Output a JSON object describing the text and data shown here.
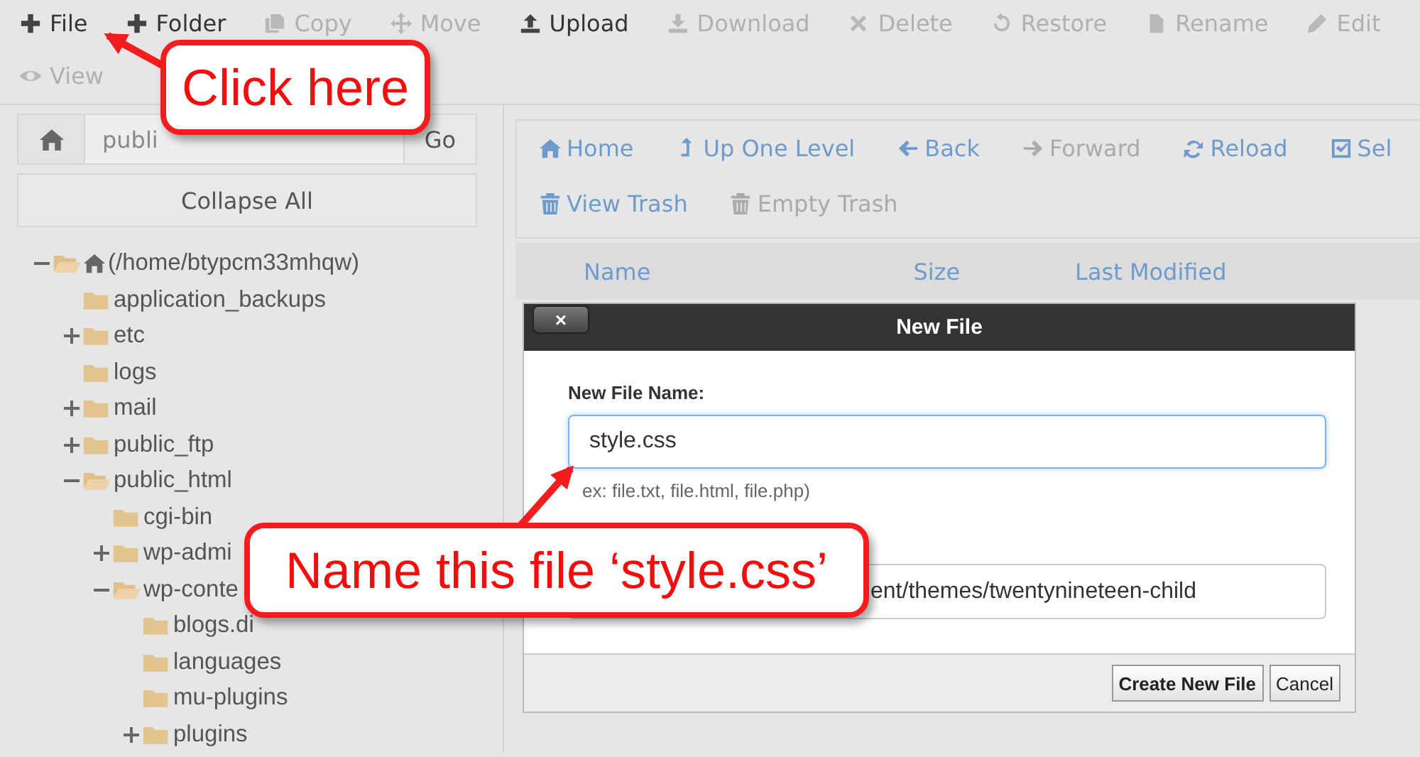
{
  "toolbar": {
    "rows": [
      [
        {
          "label": "File",
          "kind": "plus",
          "disabled": false
        },
        {
          "label": "Folder",
          "kind": "plus",
          "disabled": false
        },
        {
          "label": "Copy",
          "kind": "copy",
          "disabled": true
        },
        {
          "label": "Move",
          "kind": "move",
          "disabled": true
        },
        {
          "label": "Upload",
          "kind": "upload",
          "disabled": false
        },
        {
          "label": "Download",
          "kind": "download",
          "disabled": true
        },
        {
          "label": "Delete",
          "kind": "delete",
          "disabled": true
        },
        {
          "label": "Restore",
          "kind": "restore",
          "disabled": true
        },
        {
          "label": "Rename",
          "kind": "file",
          "disabled": true
        },
        {
          "label": "Edit",
          "kind": "pencil",
          "disabled": true
        }
      ],
      [
        {
          "label": "View",
          "kind": "eye",
          "disabled": true
        }
      ]
    ]
  },
  "path_bar": {
    "value": "publi",
    "go_label": "Go"
  },
  "collapse_label": "Collapse All",
  "tree": [
    {
      "label": "(/home/btypcm33mhqw)",
      "kind": "home",
      "expandable": true,
      "expanded": true,
      "children": [
        {
          "label": "application_backups",
          "kind": "folder",
          "expandable": false,
          "expanded": false
        },
        {
          "label": "etc",
          "kind": "folder",
          "expandable": true,
          "expanded": false
        },
        {
          "label": "logs",
          "kind": "folder",
          "expandable": false,
          "expanded": false
        },
        {
          "label": "mail",
          "kind": "folder",
          "expandable": true,
          "expanded": false
        },
        {
          "label": "public_ftp",
          "kind": "folder",
          "expandable": true,
          "expanded": false
        },
        {
          "label": "public_html",
          "kind": "folder",
          "expandable": true,
          "expanded": true,
          "children": [
            {
              "label": "cgi-bin",
              "kind": "folder",
              "expandable": false,
              "expanded": false
            },
            {
              "label": "wp-admi",
              "kind": "folder",
              "expandable": true,
              "expanded": false
            },
            {
              "label": "wp-conte",
              "kind": "folder",
              "expandable": true,
              "expanded": true,
              "children": [
                {
                  "label": "blogs.di",
                  "kind": "folder",
                  "expandable": false,
                  "expanded": false
                },
                {
                  "label": "languages",
                  "kind": "folder",
                  "expandable": false,
                  "expanded": false
                },
                {
                  "label": "mu-plugins",
                  "kind": "folder",
                  "expandable": false,
                  "expanded": false
                },
                {
                  "label": "plugins",
                  "kind": "folder",
                  "expandable": true,
                  "expanded": false
                }
              ]
            }
          ]
        }
      ]
    }
  ],
  "nav": {
    "rows": [
      [
        {
          "label": "Home",
          "kind": "home",
          "disabled": false
        },
        {
          "label": "Up One Level",
          "kind": "up",
          "disabled": false
        },
        {
          "label": "Back",
          "kind": "back",
          "disabled": false
        },
        {
          "label": "Forward",
          "kind": "forward",
          "disabled": true
        },
        {
          "label": "Reload",
          "kind": "reload",
          "disabled": false
        },
        {
          "label": "Sel",
          "kind": "check",
          "disabled": false
        }
      ],
      [
        {
          "label": "View Trash",
          "kind": "trash",
          "disabled": false
        },
        {
          "label": "Empty Trash",
          "kind": "trash",
          "disabled": true
        }
      ]
    ]
  },
  "table": {
    "columns": [
      "Name",
      "Size",
      "Last Modified"
    ]
  },
  "dialog": {
    "title": "New File",
    "close_label": "×",
    "name_label": "New File Name:",
    "name_value": "style.css",
    "hint": "ex: file.txt, file.html, file.php)",
    "dir_value": "ent/themes/twentynineteen-child",
    "buttons": [
      "Create New File",
      "Cancel"
    ]
  },
  "callouts": [
    {
      "text": "Click here"
    },
    {
      "text": "Name this file ‘style.css’"
    }
  ]
}
